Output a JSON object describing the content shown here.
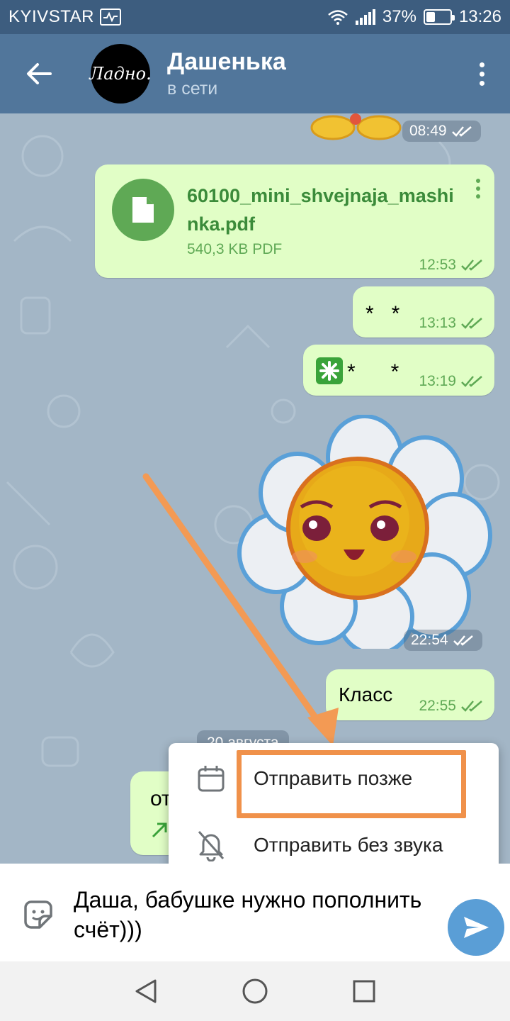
{
  "status_bar": {
    "carrier": "KYIVSTAR",
    "battery": "37%",
    "time": "13:26",
    "battery_level": 0.37
  },
  "header": {
    "contact_name": "Дашенька",
    "contact_status": "в сети",
    "avatar_text": "Ладно."
  },
  "messages": {
    "sticker_top_time": "08:49",
    "file": {
      "name": "60100_mini_shvejnaja_mashinka.pdf",
      "size": "540,3 KB PDF",
      "time": "12:53"
    },
    "stars1": {
      "text": "*   *",
      "time": "13:13"
    },
    "stars2": {
      "text": "*      *",
      "time": "13:19"
    },
    "flower_time": "22:54",
    "klass": {
      "text": "Класс",
      "time": "22:55"
    },
    "date_divider": "20 августа",
    "partial_text": "от"
  },
  "popup": {
    "send_later": "Отправить позже",
    "send_silent": "Отправить без звука"
  },
  "input": {
    "value": "Даша, бабушке нужно пополнить счёт)))"
  },
  "colors": {
    "header": "#51769b",
    "status_bar": "#3d5d7f",
    "bubble": "#e1fec6",
    "accent_green": "#5fa955",
    "send_button": "#5a9ed6",
    "highlight": "#f0914a"
  }
}
